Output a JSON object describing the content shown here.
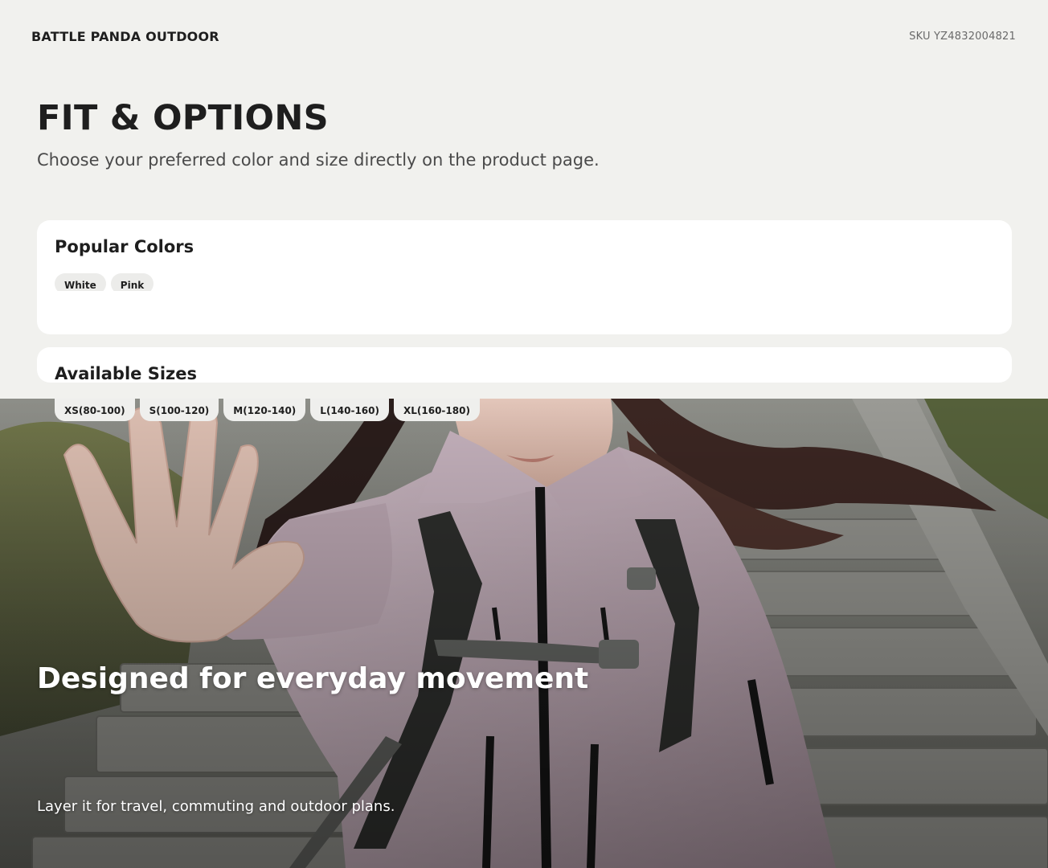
{
  "header": {
    "brand": "BATTLE PANDA OUTDOOR",
    "sku": "SKU YZ4832004821"
  },
  "intro": {
    "title": "FIT & OPTIONS",
    "subtitle": "Choose your preferred color and size directly on the product page."
  },
  "colors": {
    "title": "Popular Colors",
    "options": [
      "White",
      "Pink"
    ]
  },
  "sizes": {
    "title": "Available Sizes",
    "options": [
      "XS(80-100)",
      "S(100-120)",
      "M(120-140)",
      "L(140-160)",
      "XL(160-180)"
    ]
  },
  "hero": {
    "title": "Designed for everyday movement",
    "subtitle": "Layer it for travel, commuting and outdoor plans."
  },
  "theme": {
    "background": "#f1f1ee",
    "card": "#ffffff",
    "chip": "#ececea",
    "jacket": "#b9a5b0"
  }
}
